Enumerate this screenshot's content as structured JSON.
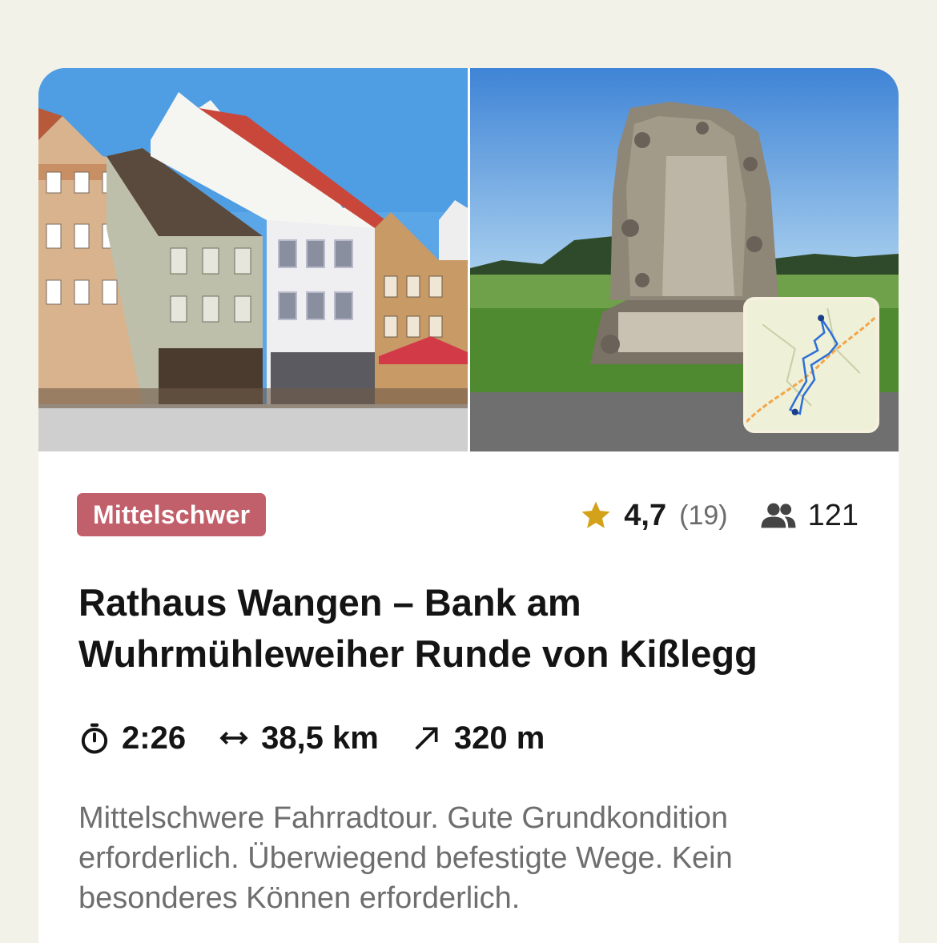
{
  "tour": {
    "difficulty_label": "Mittelschwer",
    "rating": "4,7",
    "rating_count": "(19)",
    "participants": "121",
    "title": "Rathaus Wangen – Bank am Wuhrmühleweiher Runde von Kißlegg",
    "duration": "2:26",
    "distance": "38,5 km",
    "elevation": "320 m",
    "description": "Mittelschwere Fahrradtour. Gute Grundkondition erforderlich. Überwiegend befestigte Wege. Kein besonderes Können erforderlich."
  },
  "icons": {
    "rating": "star-icon",
    "participants": "people-icon",
    "duration": "stopwatch-icon",
    "distance": "horizontal-arrows-icon",
    "elevation": "diagonal-arrow-up-icon"
  },
  "colors": {
    "background": "#f3f2e8",
    "card": "#ffffff",
    "badge": "#c15f6a",
    "star": "#d4a21a",
    "text_primary": "#141414",
    "text_secondary": "#6e6e6e",
    "route": "#2f6fd6"
  }
}
